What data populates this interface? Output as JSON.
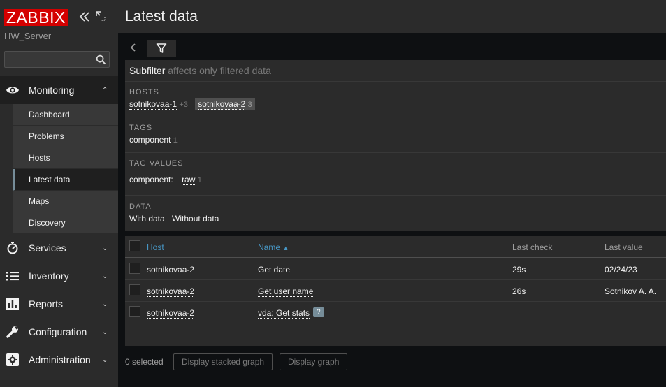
{
  "sidebar": {
    "logo": "ZABBIX",
    "server_name": "HW_Server",
    "search": {
      "value": "",
      "placeholder": ""
    },
    "menu": [
      {
        "label": "Monitoring",
        "icon": "eye-icon",
        "expanded": true,
        "items": [
          "Dashboard",
          "Problems",
          "Hosts",
          "Latest data",
          "Maps",
          "Discovery"
        ],
        "selected": "Latest data"
      },
      {
        "label": "Services",
        "icon": "stopwatch-icon"
      },
      {
        "label": "Inventory",
        "icon": "list-icon"
      },
      {
        "label": "Reports",
        "icon": "bar-chart-icon"
      },
      {
        "label": "Configuration",
        "icon": "wrench-icon"
      },
      {
        "label": "Administration",
        "icon": "cog-icon"
      }
    ]
  },
  "page": {
    "title": "Latest data"
  },
  "subfilter": {
    "title": "Subfilter",
    "subtitle": "affects only filtered data",
    "hosts": {
      "label": "HOSTS",
      "items": [
        {
          "name": "sotnikovaa-1",
          "count": "+3",
          "selected": false
        },
        {
          "name": "sotnikovaa-2",
          "count": "3",
          "selected": true
        }
      ]
    },
    "tags": {
      "label": "TAGS",
      "items": [
        {
          "name": "component",
          "count": "1"
        }
      ]
    },
    "tag_values": {
      "label": "TAG VALUES",
      "tag": "component:",
      "items": [
        {
          "name": "raw",
          "count": "1"
        }
      ]
    },
    "data": {
      "label": "DATA",
      "items": [
        "With data",
        "Without data"
      ]
    }
  },
  "table": {
    "columns": {
      "host": "Host",
      "name": "Name",
      "last_check": "Last check",
      "last_value": "Last value"
    },
    "sort_indicator": "▲",
    "rows": [
      {
        "host": "sotnikovaa-2",
        "name": "Get date",
        "last_check": "29s",
        "last_value": "02/24/23"
      },
      {
        "host": "sotnikovaa-2",
        "name": "Get user name",
        "last_check": "26s",
        "last_value": "Sotnikov A. A."
      },
      {
        "host": "sotnikovaa-2",
        "name": "vda: Get stats",
        "last_check": "",
        "last_value": "",
        "hint": "?"
      }
    ]
  },
  "footer": {
    "selected": "0 selected",
    "buttons": [
      "Display stacked graph",
      "Display graph"
    ]
  },
  "colors": {
    "brand": "#d40000",
    "link": "#4796c4",
    "sidebar_bg": "#2b2b2b",
    "page_bg": "#0e1012"
  }
}
